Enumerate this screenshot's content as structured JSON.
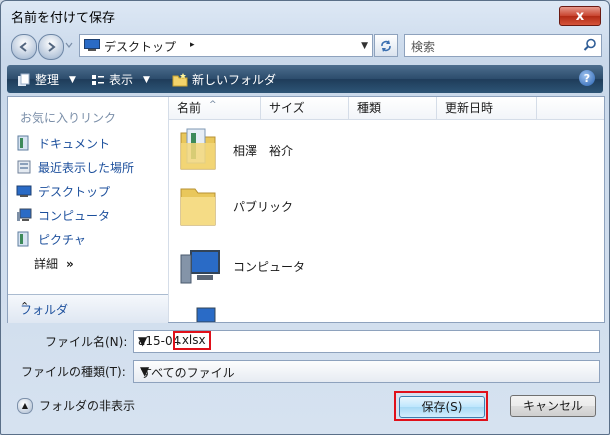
{
  "window": {
    "title": "名前を付けて保存",
    "close_label": "x"
  },
  "address": {
    "location": "デスクトップ",
    "arrow": "▸",
    "search_placeholder": "検索"
  },
  "toolbar": {
    "organize": "整理",
    "views": "表示",
    "new_folder": "新しいフォルダ",
    "help": "?"
  },
  "sidebar": {
    "header": "お気に入りリンク",
    "items": [
      {
        "label": "ドキュメント",
        "icon": "documents-icon"
      },
      {
        "label": "最近表示した場所",
        "icon": "recent-places-icon"
      },
      {
        "label": "デスクトップ",
        "icon": "desktop-icon"
      },
      {
        "label": "コンピュータ",
        "icon": "computer-icon"
      },
      {
        "label": "ピクチャ",
        "icon": "pictures-icon"
      }
    ],
    "details": "詳細",
    "details_chevron": "»",
    "folders_label": "フォルダ",
    "folders_chevron": "⌃"
  },
  "columns": [
    "名前",
    "サイズ",
    "種類",
    "更新日時"
  ],
  "files": [
    {
      "name": "相澤　裕介",
      "icon": "user-folder-icon"
    },
    {
      "name": "パブリック",
      "icon": "folder-icon"
    },
    {
      "name": "コンピュータ",
      "icon": "computer-icon"
    }
  ],
  "form": {
    "filename_label": "ファイル名(N):",
    "filename_prefix": "a15-04",
    "filename_ext": ".xlsx",
    "filetype_label": "ファイルの種類(T):",
    "filetype_value": "すべてのファイル",
    "hide_folders": "フォルダの非表示",
    "save_label": "保存(S)",
    "cancel_label": "キャンセル"
  }
}
